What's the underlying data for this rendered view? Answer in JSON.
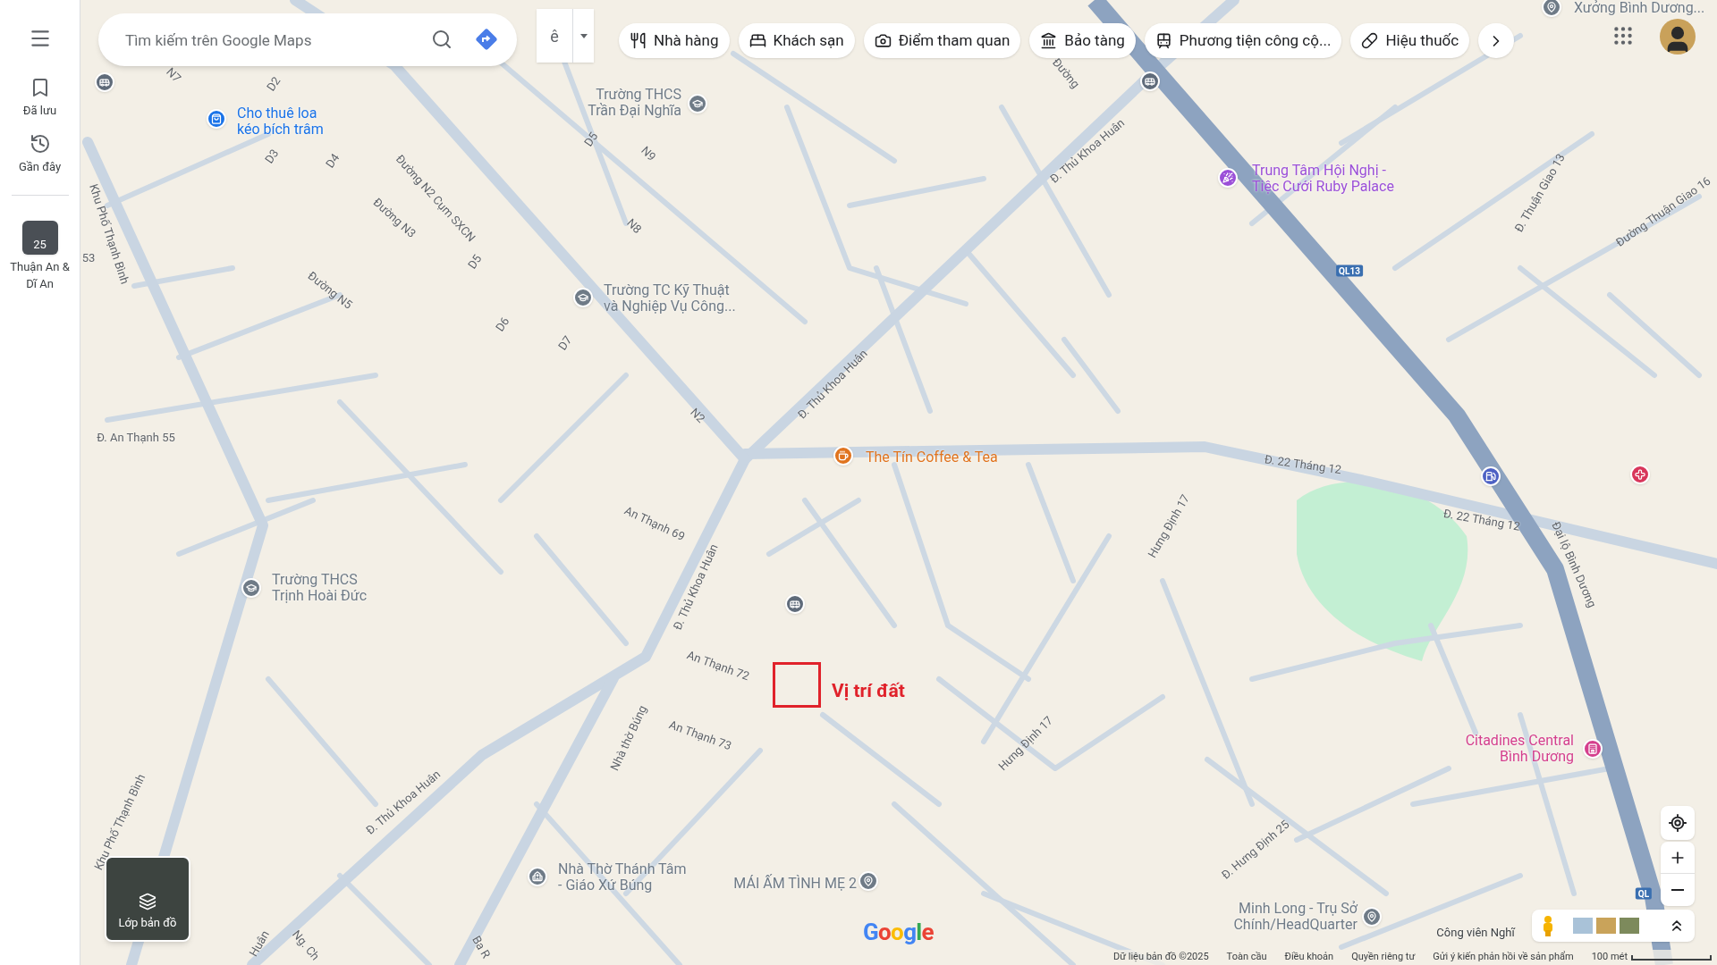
{
  "sidebar": {
    "items": [
      {
        "kind": "saved",
        "label": "Đã lưu"
      },
      {
        "kind": "recent",
        "label": "Gần đây"
      },
      {
        "kind": "area",
        "label": "Thuận An & Dĩ An",
        "badge": "25"
      }
    ]
  },
  "search": {
    "placeholder": "Tìm kiếm trên Google Maps"
  },
  "input_tool": {
    "label": "ê"
  },
  "categories": [
    {
      "kind": "restaurant",
      "label": "Nhà hàng"
    },
    {
      "kind": "hotel",
      "label": "Khách sạn"
    },
    {
      "kind": "attraction",
      "label": "Điểm tham quan"
    },
    {
      "kind": "museum",
      "label": "Bảo tàng"
    },
    {
      "kind": "transit",
      "label": "Phương tiện công cộ..."
    },
    {
      "kind": "pharmacy",
      "label": "Hiệu thuốc"
    }
  ],
  "map": {
    "road_labels": [
      "D2",
      "D3",
      "D4",
      "D5",
      "D5",
      "D6",
      "D7",
      "N9",
      "N8",
      "N7",
      "Đường N2 Cụm SXCN",
      "Đường N3",
      "Đường N5",
      "Khu Phố Thạnh Bình",
      "53",
      "Đường",
      "Đ. Thủ Khoa Huân",
      "Đ. Thuận Giao 13",
      "Đường Thuận Giao 16",
      "Đ. An Thạnh 55",
      "N2",
      "An Thạnh 69",
      "Đ. Thủ Khoa Huân",
      "Đ. Thủ Khoa Huân",
      "An Thạnh 72",
      "An Thạnh 73",
      "Nhà thờ Búng",
      "Đ. Thủ Khoa Huân",
      "Khu Phố Thạnh Bình",
      "Huân",
      "Ng. Ch",
      "Ba R",
      "Đ. 22 Tháng 12",
      "Đ. 22 Tháng 12",
      "Hưng Định 17",
      "Hưng Định 17",
      "Đ. Hưng Định 25",
      "Đại lộ Bình Dương",
      "Công viên Nghĩ"
    ],
    "route_badges": [
      "QL13",
      "QL"
    ],
    "places": [
      {
        "kind": "shop",
        "lines": [
          "Cho thuê loa",
          "kéo bích trâm"
        ],
        "color": "#1a73e8"
      },
      {
        "kind": "school",
        "lines": [
          "Trường THCS",
          "Trần Đại Nghĩa"
        ],
        "color": "#6f7b87"
      },
      {
        "kind": "school",
        "lines": [
          "Trường TC Kỹ Thuật",
          "và Nghiệp Vụ Công..."
        ],
        "color": "#6f7b87"
      },
      {
        "kind": "venue",
        "lines": [
          "Trung Tâm Hội Nghị -",
          "Tiệc Cưới Ruby Palace"
        ],
        "color": "#9b4fd8"
      },
      {
        "kind": "place",
        "lines": [
          "Xưởng Bình Dương..."
        ],
        "color": "#6f7b87"
      },
      {
        "kind": "cafe",
        "lines": [
          "The Tín Coffee & Tea"
        ],
        "color": "#e0741f"
      },
      {
        "kind": "school",
        "lines": [
          "Trường THCS",
          "Trịnh Hoài Đức"
        ],
        "color": "#6f7b87"
      },
      {
        "kind": "gas",
        "color": "#4d61c4"
      },
      {
        "kind": "hospital",
        "color": "#d8365b"
      },
      {
        "kind": "hotel",
        "lines": [
          "Citadines Central",
          "Bình Dương"
        ],
        "color": "#d43f8d"
      },
      {
        "kind": "church",
        "lines": [
          "Nhà Thờ Thánh Tâm",
          "- Giáo Xứ Búng"
        ],
        "color": "#6f7b87"
      },
      {
        "kind": "place",
        "lines": [
          "MÁI ẤM TÌNH MẸ 2"
        ],
        "color": "#6f7b87"
      },
      {
        "kind": "place",
        "lines": [
          "Minh Long - Trụ Sở",
          "Chính/HeadQuarter"
        ],
        "color": "#6f7b87"
      },
      {
        "kind": "bus",
        "color": "#5f6b7a"
      },
      {
        "kind": "bus",
        "color": "#5f6b7a"
      },
      {
        "kind": "bus",
        "color": "#5f6b7a"
      }
    ],
    "marker": {
      "label": "Vị trí đất"
    }
  },
  "layers_button": {
    "label": "Lớp bản đồ"
  },
  "logo": "Google",
  "footer": {
    "links": [
      "Dữ liệu bản đồ ©2025",
      "Toàn cầu",
      "Điều khoản",
      "Quyền riêng tư",
      "Gửi ý kiến phản hồi về sản phẩm"
    ],
    "scale": "100 mét"
  }
}
